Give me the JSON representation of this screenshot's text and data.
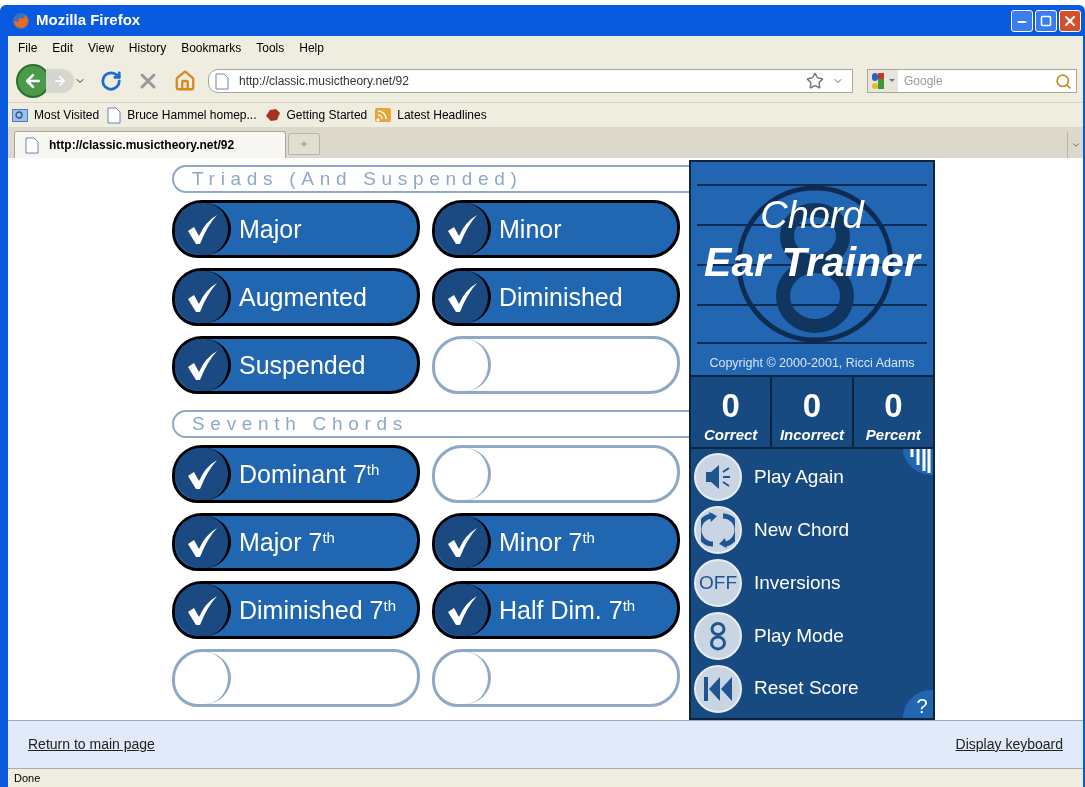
{
  "window": {
    "title": "Mozilla Firefox"
  },
  "menu": [
    "File",
    "Edit",
    "View",
    "History",
    "Bookmarks",
    "Tools",
    "Help"
  ],
  "address_bar": {
    "value": "http://classic.musictheory.net/92"
  },
  "search": {
    "placeholder": "Google"
  },
  "bookmarks": [
    {
      "label": "Most Visited",
      "kind": "folder"
    },
    {
      "label": "Bruce Hammel homep...",
      "kind": "page"
    },
    {
      "label": "Getting Started",
      "kind": "start"
    },
    {
      "label": "Latest Headlines",
      "kind": "feed"
    }
  ],
  "tabs": [
    {
      "label": "http://classic.musictheory.net/92",
      "selected": true
    }
  ],
  "sections": [
    {
      "title": "Triads (And Suspended)",
      "chords": [
        {
          "label": "Major",
          "checked": true
        },
        {
          "label": "Minor",
          "checked": true
        },
        {
          "label": "Augmented",
          "checked": true
        },
        {
          "label": "Diminished",
          "checked": true
        },
        {
          "label": "Suspended",
          "checked": true
        },
        {
          "checked": false
        }
      ]
    },
    {
      "title": "Seventh Chords",
      "chords": [
        {
          "label": "Dominant 7$^{th}$",
          "checked": true
        },
        {
          "checked": false
        },
        {
          "label": "Major 7$^{th}$",
          "checked": true
        },
        {
          "label": "Minor 7$^{th}$",
          "checked": true
        },
        {
          "label": "Diminished 7$^{th}$",
          "checked": true
        },
        {
          "label": "Half Dim. 7$^{th}$",
          "checked": true
        },
        {
          "checked": false
        },
        {
          "checked": false
        }
      ]
    }
  ],
  "panel": {
    "title_line1": "Chord",
    "title_line2": "Ear Trainer",
    "copyright": "Copyright © 2000-2001, Ricci Adams",
    "scores": [
      {
        "value": "0",
        "label": "Correct"
      },
      {
        "value": "0",
        "label": "Incorrect"
      },
      {
        "value": "0",
        "label": "Percent"
      }
    ],
    "controls": [
      {
        "label": "Play Again",
        "kind": "speaker"
      },
      {
        "label": "New Chord",
        "kind": "cycle"
      },
      {
        "label": "Inversions",
        "kind": "text",
        "icon_text": "OFF"
      },
      {
        "label": "Play Mode",
        "kind": "chord"
      },
      {
        "label": "Reset Score",
        "kind": "rewind"
      }
    ],
    "help": "?"
  },
  "footer": {
    "left_link": "Return to main page",
    "right_link": "Display keyboard"
  },
  "status_bar": "Done"
}
